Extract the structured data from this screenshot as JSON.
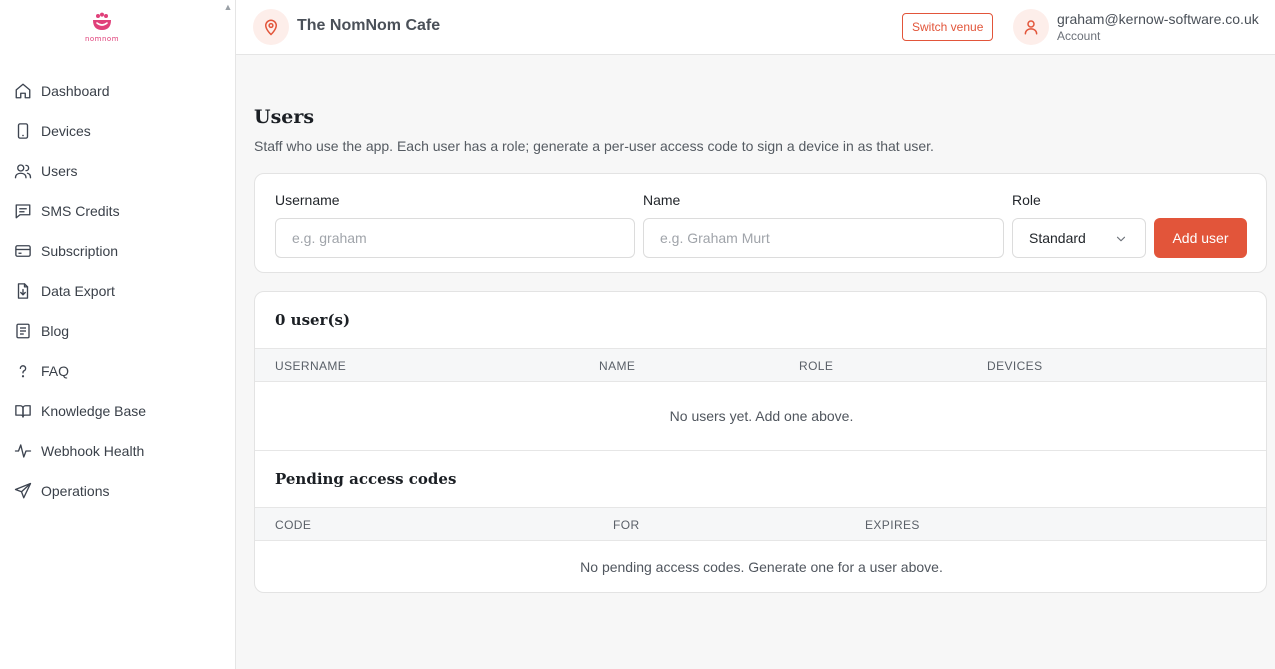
{
  "brand": {
    "logo_text": "nomnom"
  },
  "sidebar": {
    "items": [
      {
        "label": "Dashboard",
        "icon": "home-icon"
      },
      {
        "label": "Devices",
        "icon": "device-icon"
      },
      {
        "label": "Users",
        "icon": "users-icon"
      },
      {
        "label": "SMS Credits",
        "icon": "message-icon"
      },
      {
        "label": "Subscription",
        "icon": "card-icon"
      },
      {
        "label": "Data Export",
        "icon": "file-download-icon"
      },
      {
        "label": "Blog",
        "icon": "document-icon"
      },
      {
        "label": "FAQ",
        "icon": "question-icon"
      },
      {
        "label": "Knowledge Base",
        "icon": "book-icon"
      },
      {
        "label": "Webhook Health",
        "icon": "pulse-icon"
      },
      {
        "label": "Operations",
        "icon": "send-icon"
      }
    ]
  },
  "header": {
    "venue": "The NomNom Cafe",
    "switch_label": "Switch venue",
    "email": "graham@kernow-software.co.uk",
    "account_label": "Account"
  },
  "page": {
    "title": "Users",
    "description": "Staff who use the app. Each user has a role; generate a per-user access code to sign a device in as that user."
  },
  "form": {
    "username_label": "Username",
    "username_placeholder": "e.g. graham",
    "name_label": "Name",
    "name_placeholder": "e.g. Graham Murt",
    "role_label": "Role",
    "role_value": "Standard",
    "add_label": "Add user"
  },
  "users_table": {
    "title": "0 user(s)",
    "columns": [
      "USERNAME",
      "NAME",
      "ROLE",
      "DEVICES"
    ],
    "empty": "No users yet. Add one above."
  },
  "codes_table": {
    "title": "Pending access codes",
    "columns": [
      "CODE",
      "FOR",
      "EXPIRES"
    ],
    "empty": "No pending access codes. Generate one for a user above."
  },
  "colors": {
    "accent": "#e2553a",
    "brand_pink": "#e0407a"
  }
}
